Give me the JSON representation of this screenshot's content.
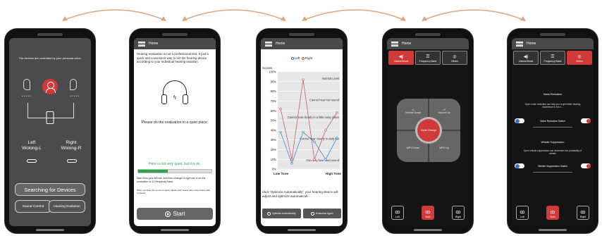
{
  "phone1": {
    "message": "The devices are controlled by your personal voice.",
    "left_label": "Left",
    "left_device": "Wolong-L",
    "right_label": "Right",
    "right_device": "Wolong-R",
    "search_button": "Searching for Devices",
    "sound_control_button": "Sound Control",
    "hearing_eval_button": "Hearing Evalution"
  },
  "phone2": {
    "header": "Home",
    "intro": "Hearing evaluation is not a professional test. It just a quick and convenient way to set the hearing device according to your individual hearing situation.",
    "quiet_text": "Please do the evaluation in a quiet place.",
    "ok_text": "Here is not very quiet, but it is ok.",
    "noise_level": 0.4,
    "instruction": "Start from your left ear, and then change to right ear to do the evaluation of 10 frequency band.",
    "hint": "When you hear the sound of signal, please click 'heard' other wise please click 'unheard'",
    "start_button": "Start"
  },
  "phone3": {
    "header": "Home",
    "legend_left": "Left",
    "legend_right": "Right",
    "note": "Click 'Optimize Automatically', your hearing device will adjust and optimize automaticall...",
    "optimize_button": "Optimize Automatically",
    "evaluation_again_button": "Evaluation Again"
  },
  "chart_data": {
    "type": "line",
    "ylabel": "Scores",
    "y_ticks": [
      "100%",
      "90%",
      "80%",
      "70%",
      "60%",
      "50%",
      "40%",
      "30%",
      "20%",
      "10%",
      "0%"
    ],
    "ylim": [
      0,
      100
    ],
    "x_start_label": "Low Tone",
    "x_end_label": "High Tone",
    "annotations": [
      "Normal Level",
      "Cannot hear low sound",
      "Cannot hear clearly in a little noisy place",
      "Cannot hear clearly in daily life",
      "Can only hear loud sound"
    ],
    "series": [
      {
        "name": "Left",
        "color": "#2a78d6",
        "values": [
          38,
          6,
          38,
          28,
          10,
          32
        ]
      },
      {
        "name": "Right",
        "color": "#c0505a",
        "values": [
          62,
          10,
          92,
          10,
          40,
          58
        ]
      }
    ]
  },
  "phone4": {
    "header": "Home",
    "tabs": [
      "Volume/Mode",
      "Frequency Band",
      "Others"
    ],
    "volume_down": "Volume Down",
    "volume_up": "Volume Up",
    "mode_change": "Mode Change",
    "mpo_down": "MPO Down",
    "mpo_up": "MPO Up",
    "ears": [
      "Left",
      "Both",
      "Right"
    ]
  },
  "phone5": {
    "header": "Home",
    "tabs": [
      "Volume/Mode",
      "Frequency Band",
      "Others"
    ],
    "noise_title": "Noise Reduction",
    "noise_desc": "Open noise reduction can help you to get better hearing experience in the n...",
    "noise_switch": "Noise Reduction Switch",
    "whistle_title": "Whistle Suppression",
    "whistle_desc": "Open whistle suppression can decreases the probability of whistle",
    "whistle_switch": "Whistle Suppression Switch",
    "ears": [
      "Left",
      "Both",
      "Right"
    ]
  },
  "colors": {
    "accent": "#d03a3a",
    "success": "#2aa54a",
    "arrow": "#e0a57a"
  }
}
